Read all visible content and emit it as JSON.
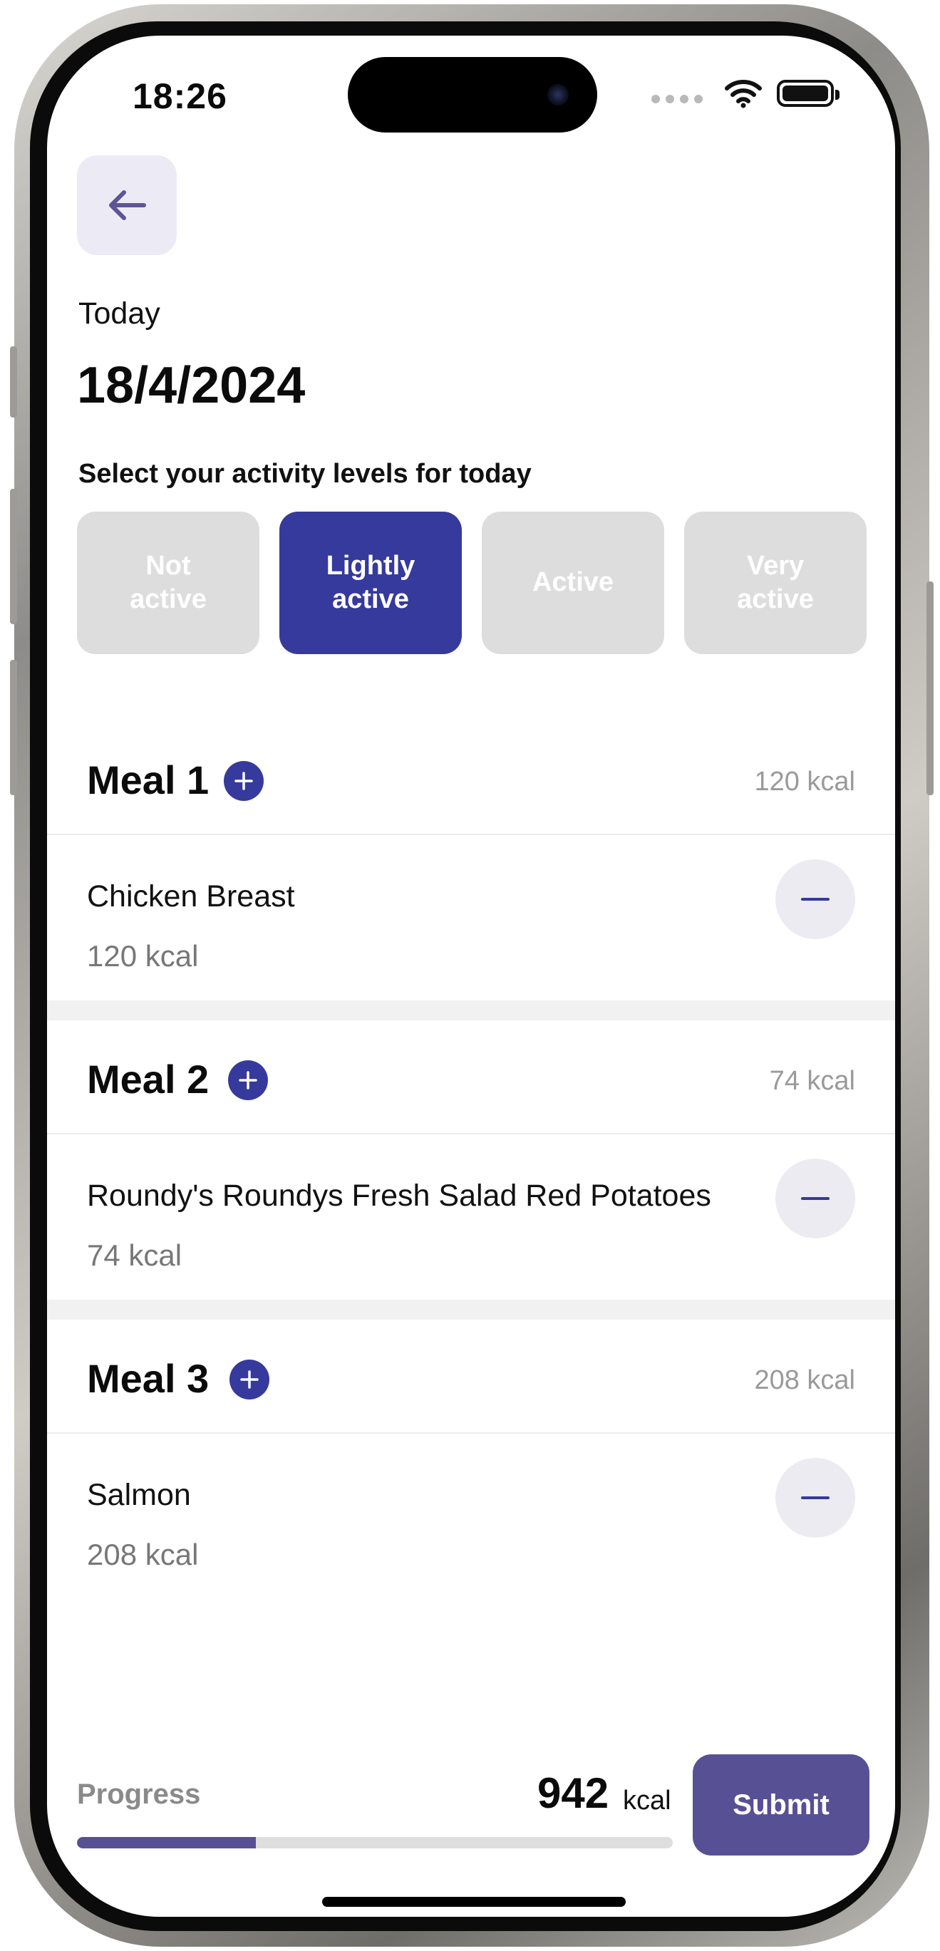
{
  "status_bar": {
    "time": "18:26"
  },
  "header": {
    "back_icon": "arrow-left-icon",
    "day_label": "Today",
    "date": "18/4/2024"
  },
  "activity": {
    "prompt": "Select your activity levels for today",
    "selected": "Lightly active",
    "options": [
      {
        "label": "Not active",
        "line1": "Not",
        "line2": "active"
      },
      {
        "label": "Lightly active",
        "line1": "Lightly",
        "line2": "active"
      },
      {
        "label": "Active",
        "line1": "Active",
        "line2": ""
      },
      {
        "label": "Very active",
        "line1": "Very",
        "line2": "active"
      }
    ]
  },
  "meals": [
    {
      "title": "Meal 1",
      "total": "120 kcal",
      "items": [
        {
          "name": "Chicken Breast",
          "kcal": "120 kcal"
        }
      ]
    },
    {
      "title": "Meal 2",
      "total": "74 kcal",
      "items": [
        {
          "name": "Roundy's Roundys Fresh Salad Red Potatoes",
          "kcal": "74 kcal"
        }
      ]
    },
    {
      "title": "Meal 3",
      "total": "208 kcal",
      "items": [
        {
          "name": "Salmon",
          "kcal": "208 kcal"
        }
      ]
    }
  ],
  "footer": {
    "progress_label": "Progress",
    "progress_fraction": 0.3,
    "total_value": "942",
    "total_unit": "kcal",
    "submit_label": "Submit"
  },
  "colors": {
    "accent": "#363a9c",
    "submit": "#585095",
    "inactive_chip": "#dddddd"
  }
}
